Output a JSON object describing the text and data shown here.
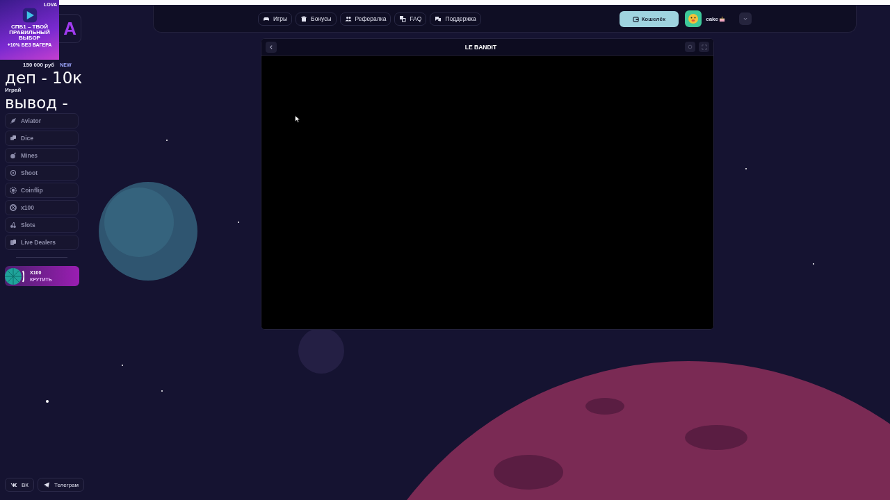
{
  "overlay": {
    "ad": {
      "brand": "LOVA",
      "headline": "СПБ1 – ТВОЙ ПРАВИЛЬНЫЙ ВЫБОР",
      "note": "+10% БЕЗ ВАГЕРА"
    },
    "caption_lines": [
      "деп - 10к",
      "вывод -"
    ]
  },
  "sidebar": {
    "logo_visible": "A",
    "jackpot": "150 000 руб",
    "jackpot_badge": "NEW",
    "section_label": "Играй",
    "games": [
      {
        "label": "Aviator"
      },
      {
        "label": "Dice"
      },
      {
        "label": "Mines"
      },
      {
        "label": "Shoot"
      },
      {
        "label": "Coinflip"
      },
      {
        "label": "x100"
      },
      {
        "label": "Slots"
      },
      {
        "label": "Live Dealers"
      }
    ],
    "spin_banner": {
      "title": "X100",
      "action": "КРУТИТЬ"
    },
    "socials": [
      {
        "label": "ВК"
      },
      {
        "label": "Телеграм"
      }
    ]
  },
  "header": {
    "nav": [
      {
        "label": "Игры"
      },
      {
        "label": "Бонусы"
      },
      {
        "label": "Рефералка"
      },
      {
        "label": "FAQ"
      },
      {
        "label": "Поддержка"
      }
    ],
    "wallet": "Кошелёк",
    "user": {
      "name": "cake"
    }
  },
  "game_window": {
    "title": "LE BANDIT"
  }
}
